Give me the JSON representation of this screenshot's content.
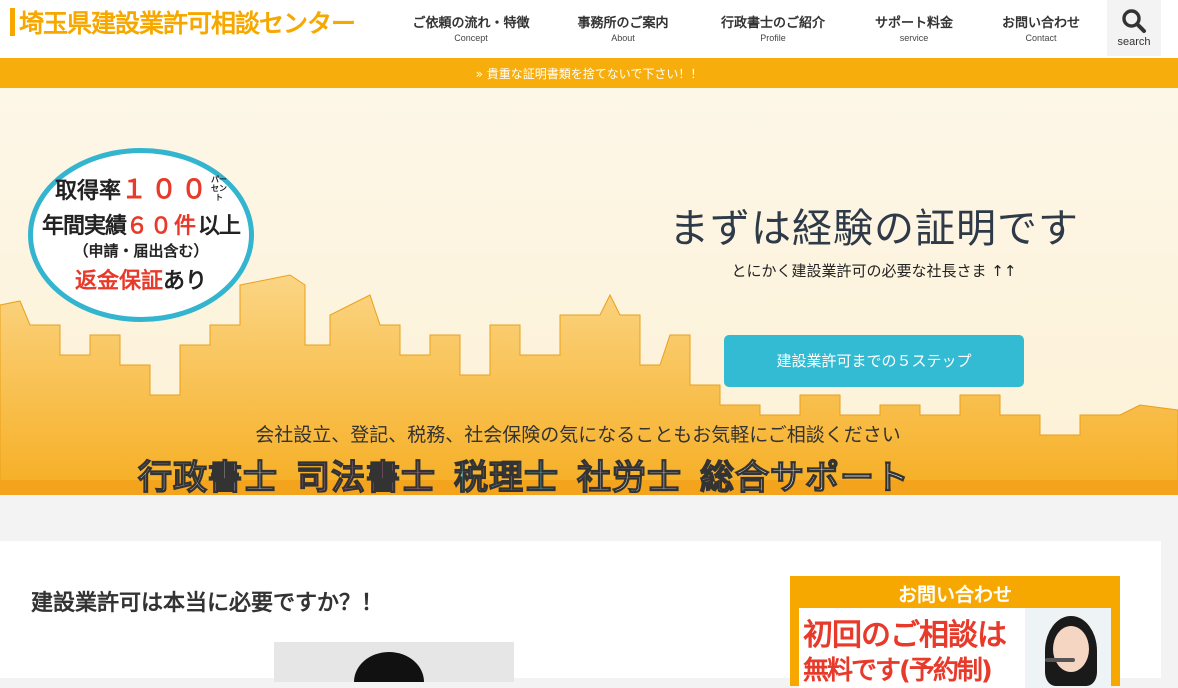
{
  "header": {
    "logo_text": "埼玉県建設業許可相談センター",
    "nav": [
      {
        "jp": "ご依頼の流れ・特徴",
        "en": "Concept"
      },
      {
        "jp": "事務所のご案内",
        "en": "About"
      },
      {
        "jp": "行政書士のご紹介",
        "en": "Profile"
      },
      {
        "jp": "サポート料金",
        "en": "service"
      },
      {
        "jp": "お問い合わせ",
        "en": "Contact"
      }
    ],
    "search_label": "search"
  },
  "notice": {
    "text": "» 貴重な証明書類を捨てないで下さい！！"
  },
  "hero": {
    "badge": {
      "rate_prefix": "取得率",
      "rate_value": "１００",
      "rate_unit": "パーセント",
      "annual_prefix": "年間実績",
      "annual_value": "６０件",
      "annual_suffix": "以上",
      "annual_note": "（申請・届出含む）",
      "guarantee_red": "返金保証",
      "guarantee_suffix": "あり"
    },
    "title": "まずは経験の証明です",
    "subtitle": "とにかく建設業許可の必要な社長さま ↑↑",
    "cta_label": "建設業許可までの５ステップ",
    "caption": "会社設立、登記、税務、社会保険の気になることもお気軽にご相談ください",
    "services": [
      "行政書士",
      "司法書士",
      "税理士",
      "社労士",
      "総合サポート"
    ]
  },
  "content": {
    "title": "建設業許可は本当に必要ですか？！",
    "sidebar": {
      "heading": "お問い合わせ",
      "line1": "初回のご相談は",
      "line2": "無料です(予約制)"
    }
  }
}
